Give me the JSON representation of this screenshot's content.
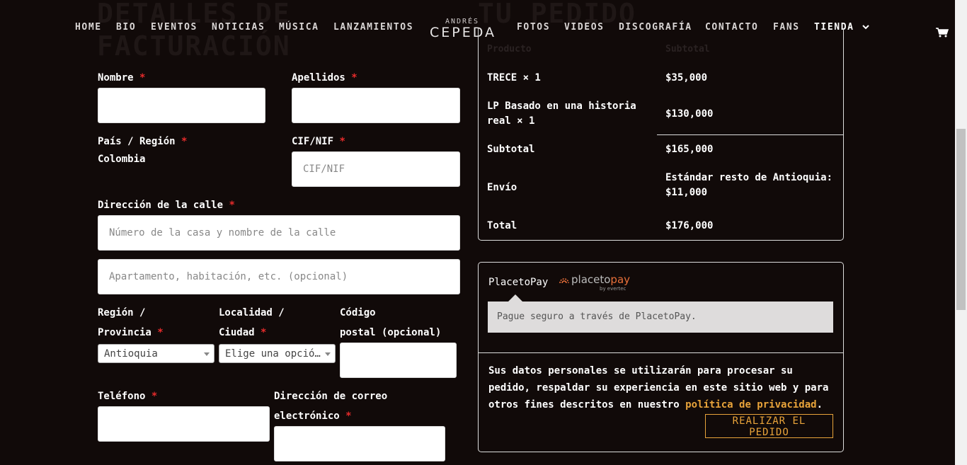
{
  "nav": {
    "items_left": [
      "HOME",
      "BIO",
      "EVENTOS",
      "NOTICIAS",
      "MÚSICA",
      "LANZAMIENTOS"
    ],
    "items_right": [
      "FOTOS",
      "VIDEOS",
      "DISCOGRAFÍA",
      "CONTACTO",
      "FANS",
      "TIENDA"
    ],
    "logo_top": "ANDRÉS",
    "logo_main": "CEPEDA"
  },
  "billing": {
    "heading_line1": "DETALLES DE",
    "heading_line2": "FACTURACIÓN",
    "required_mark": "*",
    "first_name_label": "Nombre",
    "last_name_label": "Apellidos",
    "country_label": "País / Región",
    "country_value": "Colombia",
    "tax_label": "CIF/NIF",
    "tax_placeholder": "CIF/NIF",
    "street_label": "Dirección de la calle",
    "street_placeholder": "Número de la casa y nombre de la calle",
    "street2_placeholder": "Apartamento, habitación, etc. (opcional)",
    "region_label_1": "Región /",
    "region_label_2": "Provincia",
    "region_value": "Antioquia",
    "city_label_1": "Localidad /",
    "city_label_2": "Ciudad",
    "city_value": "Elige una opció…",
    "postal_label_1": "Código",
    "postal_label_2": "postal (opcional)",
    "phone_label": "Teléfono",
    "email_label_1": "Dirección de correo",
    "email_label_2": "electrónico"
  },
  "order": {
    "heading": "TU PEDIDO",
    "col_product": "Producto",
    "col_subtotal": "Subtotal",
    "items": [
      {
        "name": "TRECE  × 1",
        "price": "$35,000"
      },
      {
        "name_line1": "LP Basado en una historia",
        "name_line2": "real  × 1",
        "price": "$130,000"
      }
    ],
    "subtotal_label": "Subtotal",
    "subtotal_value": "$165,000",
    "shipping_label": "Envío",
    "shipping_value_1": "Estándar resto de Antioquia:",
    "shipping_value_2": "$11,000",
    "total_label": "Total",
    "total_value": "$176,000"
  },
  "payment": {
    "method": "PlacetoPay",
    "logo_text_1": "placeto",
    "logo_text_2": "pay",
    "logo_sub": "by evertec",
    "description": "Pague seguro a través de PlacetoPay.",
    "privacy_line1": "Sus datos personales se utilizarán para procesar su",
    "privacy_line2": "pedido, respaldar su experiencia en este sitio web y para",
    "privacy_line3_prefix": "otros fines descritos en nuestro",
    "privacy_link": "política de privacidad",
    "privacy_suffix": ".",
    "place_order": "REALIZAR EL PEDIDO"
  },
  "colors": {
    "background": "#110a09",
    "accent": "#e8a33a",
    "required": "#e52b2b"
  }
}
